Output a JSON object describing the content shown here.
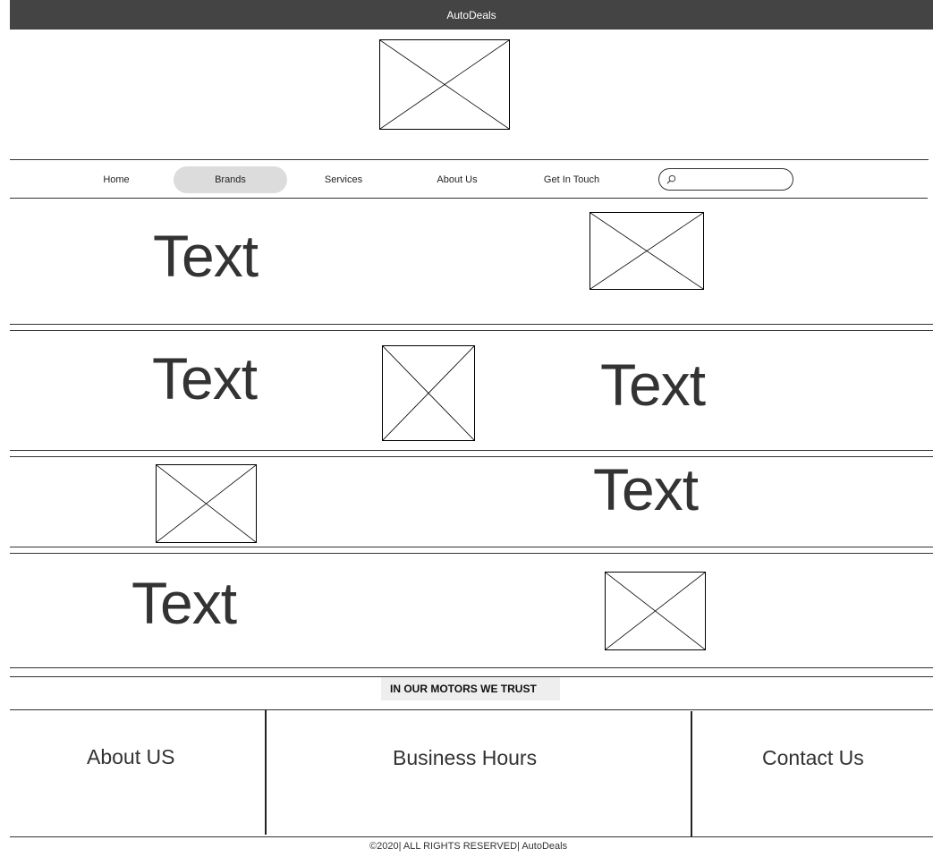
{
  "header": {
    "title": "AutoDeals"
  },
  "nav": {
    "items": [
      {
        "label": "Home"
      },
      {
        "label": "Brands"
      },
      {
        "label": "Services"
      },
      {
        "label": "About Us"
      },
      {
        "label": "Get In Touch"
      }
    ],
    "active_index": 1,
    "search": {
      "value": "",
      "placeholder": ""
    }
  },
  "sections": {
    "row1": {
      "text": "Text"
    },
    "row2": {
      "text_left": "Text",
      "text_right": "Text"
    },
    "row3": {
      "text": "Text"
    },
    "row4": {
      "text": "Text"
    }
  },
  "banner": {
    "slogan": "IN OUR MOTORS WE TRUST"
  },
  "footer": {
    "about": "About US",
    "hours": "Business Hours",
    "contact": "Contact Us",
    "copyright": "©2020| ALL RIGHTS RESERVED| AutoDeals"
  },
  "colors": {
    "topbar_bg": "#444444",
    "active_nav_bg": "#dcdcdc",
    "banner_bg": "#eeeeee"
  }
}
